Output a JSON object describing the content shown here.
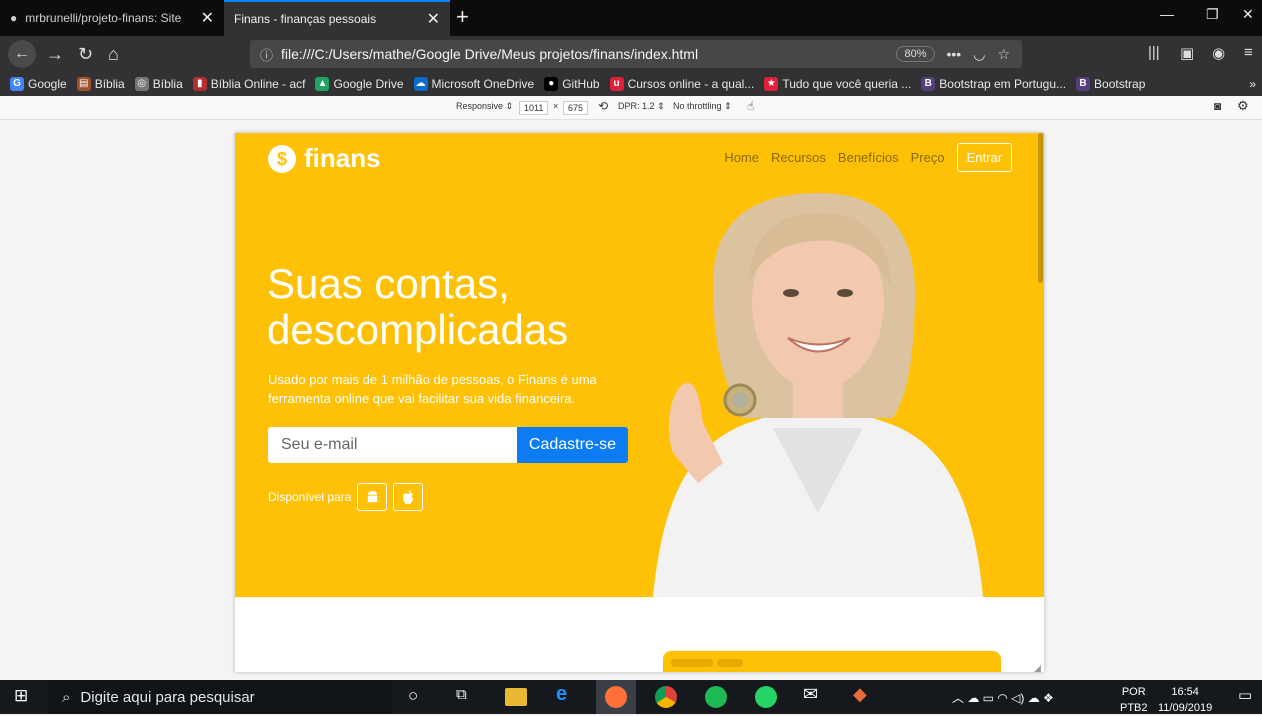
{
  "browser": {
    "tabs": [
      {
        "title": "mrbrunelli/projeto-finans: Site",
        "close": "✕"
      },
      {
        "title": "Finans - finanças pessoais",
        "close": "✕"
      }
    ],
    "new_tab": "+",
    "window_controls": {
      "minimize": "—",
      "restore": "❐",
      "close": "✕"
    },
    "url": "file:///C:/Users/mathe/Google Drive/Meus projetos/finans/index.html",
    "zoom": "80%",
    "page_actions": "•••",
    "bookmarks": [
      {
        "label": "Google",
        "color": "#4285f4",
        "glyph": "G"
      },
      {
        "label": "Bíblia",
        "color": "#a0522d",
        "glyph": "▤"
      },
      {
        "label": "Bíblia",
        "color": "#777777",
        "glyph": "◎"
      },
      {
        "label": "Bíblia Online - acf",
        "color": "#b03030",
        "glyph": "▮"
      },
      {
        "label": "Google Drive",
        "color": "#1fa463",
        "glyph": "▲"
      },
      {
        "label": "Microsoft OneDrive",
        "color": "#0a6ccf",
        "glyph": "☁"
      },
      {
        "label": "GitHub",
        "color": "#000000",
        "glyph": "●"
      },
      {
        "label": "Cursos online - a qual...",
        "color": "#e0203a",
        "glyph": "u"
      },
      {
        "label": "Tudo que você queria ...",
        "color": "#e0203a",
        "glyph": "★"
      },
      {
        "label": "Bootstrap em Portugu...",
        "color": "#563d7c",
        "glyph": "B"
      },
      {
        "label": "Bootstrap",
        "color": "#563d7c",
        "glyph": "B"
      }
    ],
    "bookmarks_more": "»"
  },
  "responsive": {
    "device": "Responsive",
    "width": "1011",
    "times": "×",
    "height": "675",
    "dpr": "DPR: 1.2",
    "throttle": "No throttling"
  },
  "site": {
    "brand": "finans",
    "brand_icon": "$",
    "nav": [
      "Home",
      "Recursos",
      "Benefícios",
      "Preço"
    ],
    "login": "Entrar",
    "headline_1": "Suas contas,",
    "headline_2": "descomplicadas",
    "subtitle": "Usado por mais de 1 milhão de pessoas, o Finans é uma ferramenta online que vai facilitar sua vida financeira.",
    "email_placeholder": "Seu e-mail",
    "signup": "Cadastre-se",
    "available": "Disponível para",
    "colors": {
      "hero": "#fec107",
      "button": "#0d7cf2"
    }
  },
  "taskbar": {
    "search_placeholder": "Digite aqui para pesquisar",
    "lang": "POR",
    "layout": "PTB2",
    "time": "16:54",
    "date": "11/09/2019"
  }
}
